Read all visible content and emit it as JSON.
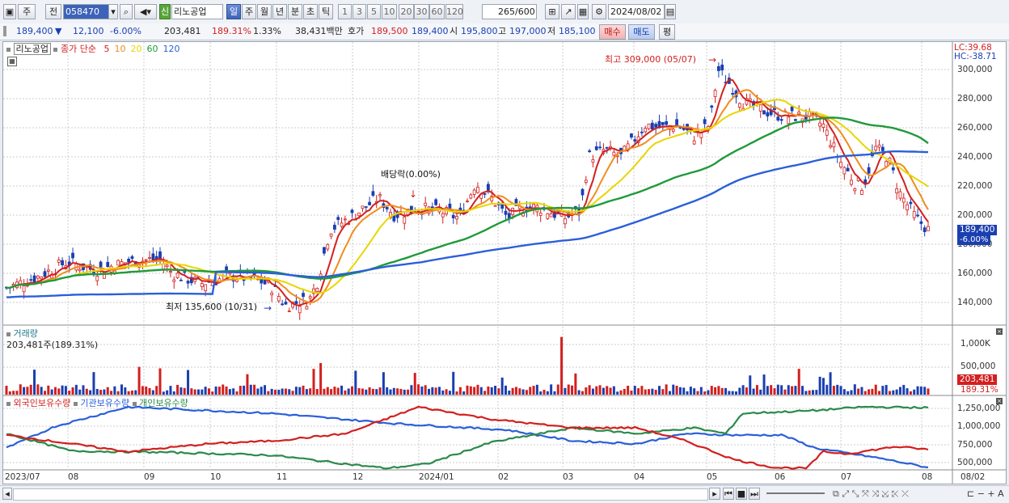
{
  "toolbar": {
    "mode": "주",
    "prev": "전",
    "code": "058470",
    "market_badge": "신",
    "stock_name": "리노공업",
    "periods": [
      "일",
      "주",
      "월",
      "년",
      "분",
      "초",
      "틱"
    ],
    "active_period": "일",
    "intervals": [
      "1",
      "3",
      "5",
      "10",
      "20",
      "30",
      "60",
      "120"
    ],
    "count": "265",
    "count_max": "/600",
    "date": "2024/08/02"
  },
  "info": {
    "price": "189,400",
    "change": "12,100",
    "change_pct": "-6.00%",
    "volume": "203,481",
    "vol_ratio": "189.31%",
    "turnover_pct": "1.33%",
    "amount": "38,431백만",
    "quote_label": "호가",
    "ask": "189,500",
    "bid": "189,400",
    "open_label": "시",
    "open": "195,800",
    "high_label": "고",
    "high": "197,000",
    "low_label": "저",
    "low": "185,100",
    "buy_btn": "매수",
    "sell_btn": "매도",
    "eval_btn": "평"
  },
  "price_pane": {
    "name_label": "리노공업",
    "ma_label": "종가 단순",
    "ma_periods": [
      "5",
      "10",
      "20",
      "60",
      "120"
    ],
    "ma_colors": [
      "#d21f1f",
      "#f08c1e",
      "#e8d600",
      "#1f9a3a",
      "#2b5fd9"
    ],
    "lc": "LC:39.68",
    "hc": "HC:-38.71",
    "high_annot": "최고 309,000 (05/07)",
    "low_annot": "최저 135,600 (10/31)",
    "div_annot": "배당락(0.00%)",
    "axis_ticks": [
      "300,000",
      "280,000",
      "260,000",
      "240,000",
      "220,000",
      "200,000",
      "180,000",
      "160,000",
      "140,000"
    ],
    "last_price_tag": "189,400",
    "last_pct_tag": "-6.00%"
  },
  "volume_pane": {
    "title": "거래량",
    "value": "203,481주(189.31%)",
    "axis_ticks": [
      "1,000K",
      "500,000"
    ],
    "tag": "203,481",
    "tag_pct": "189.31%"
  },
  "holders_pane": {
    "foreign": "외국인보유수량",
    "inst": "기관보유수량",
    "indiv": "개인보유수량",
    "axis_ticks": [
      "1,250,000",
      "1,000,000",
      "750,000",
      "500,000"
    ]
  },
  "date_axis": [
    "2023/07",
    "08",
    "09",
    "10",
    "11",
    "12",
    "2024/01",
    "02",
    "03",
    "04",
    "05",
    "06",
    "07",
    "08"
  ],
  "date_axis_end": "08/02",
  "colors": {
    "up": "#d21f1f",
    "down": "#1a3fb0",
    "foreign": "#d21f1f",
    "inst": "#2b5fd9",
    "indiv": "#2a8a4a"
  }
}
